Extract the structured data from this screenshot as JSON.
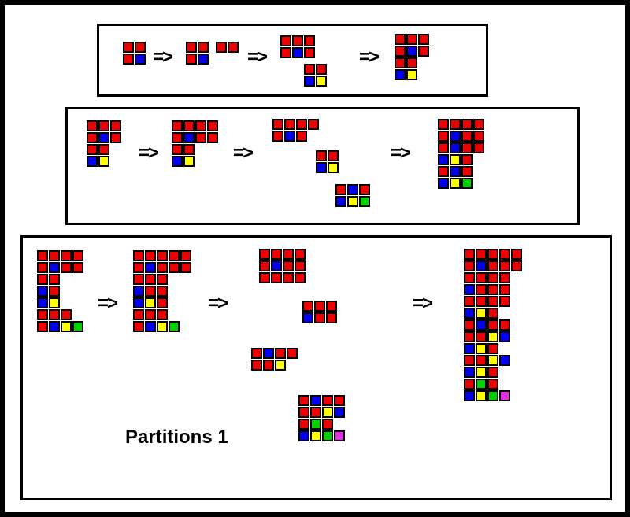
{
  "caption": "Partitions 1",
  "arrow_glyph": "=>",
  "colors": {
    "r": "#ef0000",
    "b": "#0000ef",
    "y": "#ffff00",
    "g": "#00d000",
    "m": "#e030e0"
  },
  "panels": {
    "p1": {
      "desc": "top panel, partition of 4 squares stepped through",
      "stages": [
        {
          "groups": [
            [
              [
                "r",
                "r"
              ],
              [
                "r",
                "b"
              ]
            ]
          ]
        },
        {
          "groups": [
            [
              [
                "r",
                "r"
              ],
              [
                "r",
                "b"
              ]
            ],
            [
              [
                "r",
                "r"
              ]
            ]
          ]
        },
        {
          "groups": [
            [
              [
                "r",
                "r",
                "r"
              ],
              [
                "r",
                "b",
                "r"
              ]
            ],
            [
              [
                "r",
                "r"
              ],
              [
                "b",
                "y"
              ]
            ]
          ]
        },
        {
          "groups": [
            [
              [
                "r",
                "r",
                "r"
              ],
              [
                "r",
                "b",
                "r"
              ],
              [
                "r",
                "r"
              ],
              [
                "b",
                "y"
              ]
            ]
          ]
        }
      ]
    },
    "p2": {
      "desc": "middle panel, adds green",
      "stages": [
        {
          "groups": [
            [
              [
                "r",
                "r",
                "r"
              ],
              [
                "r",
                "b",
                "r"
              ],
              [
                "r",
                "r"
              ],
              [
                "b",
                "y"
              ]
            ]
          ]
        },
        {
          "groups": [
            [
              [
                "r",
                "r",
                "r",
                "r"
              ],
              [
                "r",
                "b",
                "r",
                "r"
              ],
              [
                "r",
                "r"
              ],
              [
                "b",
                "y"
              ]
            ]
          ]
        },
        {
          "groups": [
            [
              [
                "r",
                "r",
                "r",
                "r"
              ],
              [
                "r",
                "b",
                "r"
              ]
            ],
            [
              [
                "r",
                "r"
              ],
              [
                "b",
                "y"
              ]
            ],
            [
              [
                "r",
                "b",
                "r"
              ],
              [
                "b",
                "y",
                "g"
              ]
            ]
          ]
        },
        {
          "groups": [
            [
              [
                "r",
                "r",
                "r",
                "r"
              ],
              [
                "r",
                "b",
                "r",
                "r"
              ],
              [
                "r",
                "b",
                "r",
                "r"
              ],
              [
                "b",
                "y",
                "r"
              ],
              [
                "r",
                "b",
                "r"
              ],
              [
                "b",
                "y",
                "g"
              ]
            ]
          ]
        }
      ]
    },
    "p3": {
      "desc": "bottom panel, adds magenta",
      "stages": [
        {
          "groups": [
            [
              [
                "r",
                "r",
                "r",
                "r"
              ],
              [
                "r",
                "b",
                "r",
                "r"
              ],
              [
                "r",
                "r"
              ],
              [
                "b",
                "r"
              ],
              [
                "b",
                "y"
              ],
              [
                "r",
                "r",
                "r"
              ],
              [
                "r",
                "b",
                "y",
                "g"
              ]
            ]
          ]
        },
        {
          "groups": [
            [
              [
                "r",
                "r",
                "r",
                "r",
                "r"
              ],
              [
                "r",
                "b",
                "r",
                "r",
                "r"
              ],
              [
                "r",
                "r",
                "r"
              ],
              [
                "b",
                "r",
                "r"
              ],
              [
                "b",
                "y",
                "r"
              ],
              [
                "r",
                "r",
                "r"
              ],
              [
                "r",
                "b",
                "y",
                "g"
              ]
            ]
          ]
        },
        {
          "groups": [
            [
              [
                "r",
                "r",
                "r",
                "r"
              ],
              [
                "r",
                "b",
                "r",
                "r"
              ],
              [
                "r",
                "r",
                "r",
                "r"
              ]
            ],
            [
              [
                "r",
                "r",
                "r"
              ],
              [
                "b",
                "r",
                "r"
              ]
            ],
            [
              [
                "r",
                "b",
                "r",
                "r"
              ],
              [
                "r",
                "r",
                "y"
              ]
            ],
            [
              [
                "r",
                "b",
                "r",
                "r"
              ],
              [
                "r",
                "r",
                "y",
                "b"
              ],
              [
                "r",
                "g",
                "r"
              ],
              [
                "b",
                "y",
                "g",
                "m"
              ]
            ]
          ]
        },
        {
          "groups": [
            [
              [
                "r",
                "r",
                "r",
                "r",
                "r"
              ],
              [
                "r",
                "b",
                "r",
                "r",
                "r"
              ],
              [
                "r",
                "r",
                "r",
                "r"
              ],
              [
                "b",
                "r",
                "r",
                "r"
              ],
              [
                "r",
                "r",
                "r",
                "r"
              ],
              [
                "b",
                "y",
                "r"
              ],
              [
                "r",
                "b",
                "r",
                "r"
              ],
              [
                "r",
                "r",
                "y",
                "b"
              ],
              [
                "b",
                "y",
                "r"
              ],
              [
                "r",
                "r",
                "y",
                "b"
              ],
              [
                "b",
                "y",
                "r"
              ],
              [
                "r",
                "g",
                "r"
              ],
              [
                "b",
                "y",
                "g",
                "m"
              ]
            ]
          ]
        }
      ]
    }
  }
}
